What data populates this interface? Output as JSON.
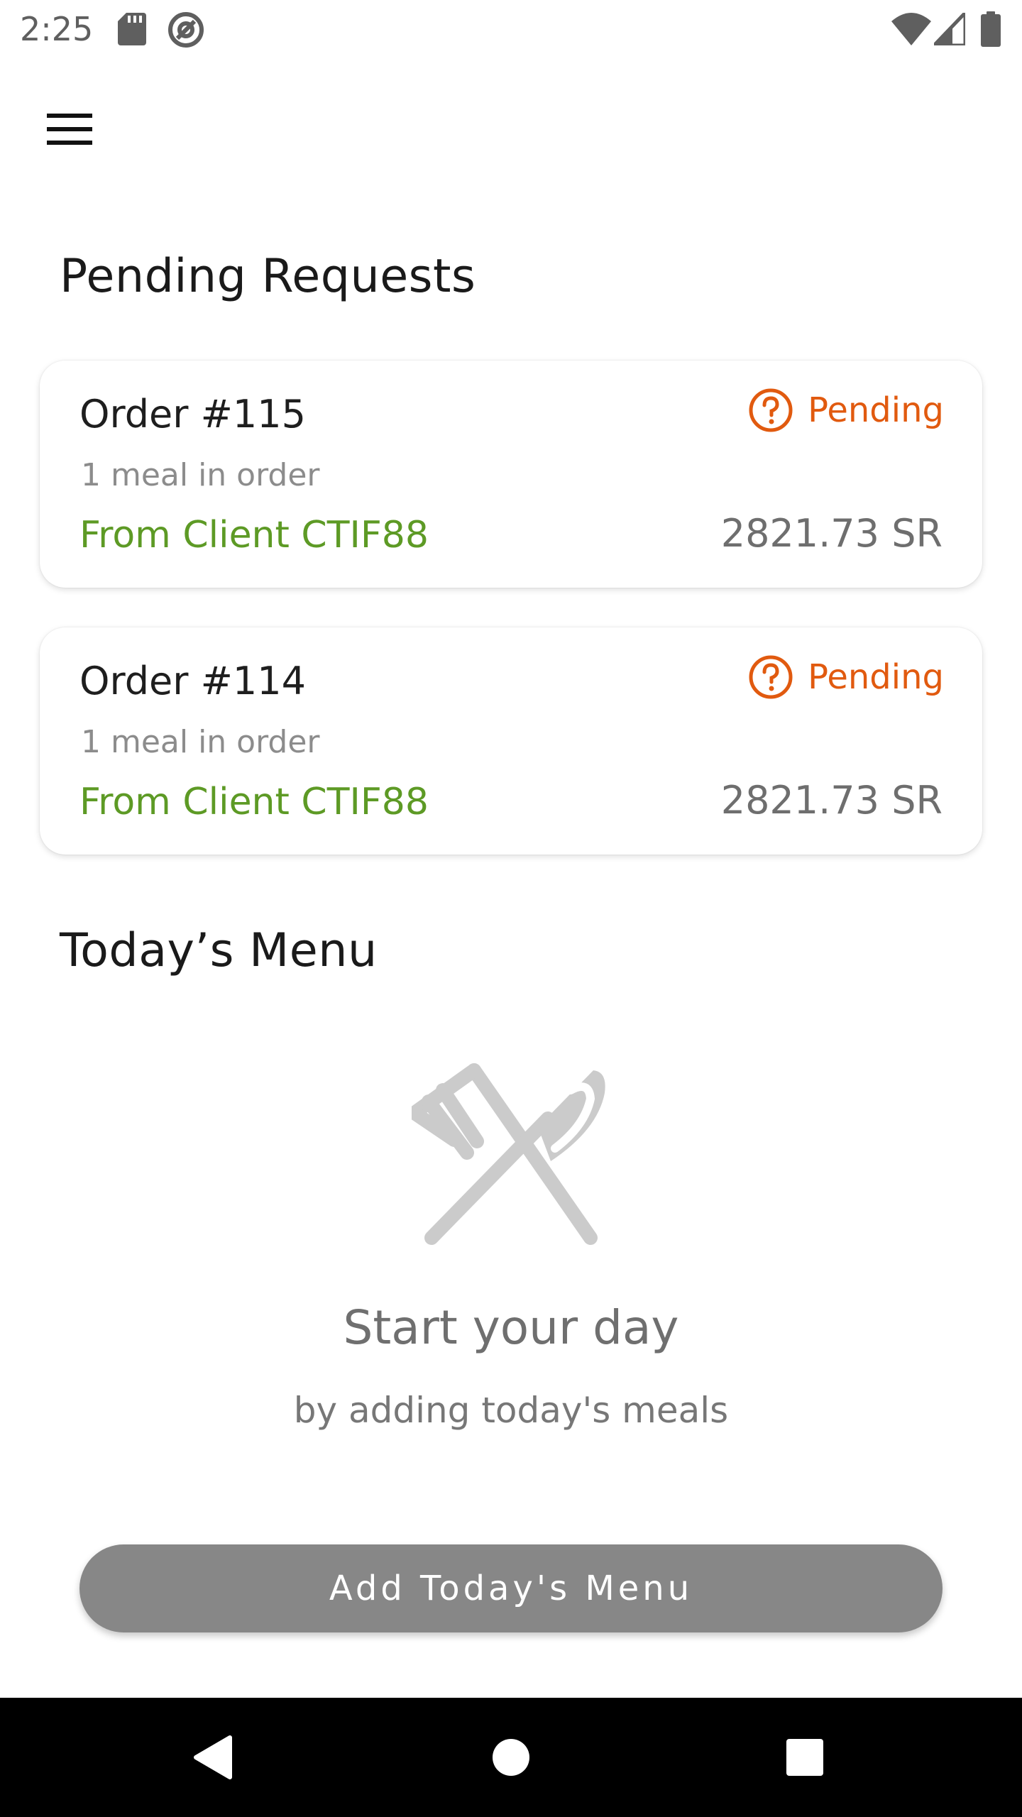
{
  "status_bar": {
    "time": "2:25",
    "left_icons": [
      "sd-card-icon",
      "at-sign-icon"
    ],
    "right_icons": [
      "wifi-icon",
      "cell-signal-icon",
      "battery-icon"
    ]
  },
  "app_bar": {
    "menu_icon": "hamburger-menu-icon"
  },
  "pending_requests": {
    "title": "Pending Requests",
    "orders": [
      {
        "number": "Order #115",
        "meals": "1 meal in order",
        "client": "From Client CTIF88",
        "price": "2821.73 SR",
        "status": "Pending"
      },
      {
        "number": "Order #114",
        "meals": "1 meal in order",
        "client": "From Client CTIF88",
        "price": "2821.73 SR",
        "status": "Pending"
      }
    ]
  },
  "todays_menu": {
    "title": "Today’s Menu",
    "empty_icon": "fork-knife-icon",
    "empty_title": "Start your day",
    "empty_subtitle": "by adding today's meals",
    "button_label": "Add Today's Menu"
  },
  "nav_bar": {
    "items": [
      "back-icon",
      "home-icon",
      "recents-icon"
    ]
  },
  "colors": {
    "pending": "#e15a0f",
    "client": "#5d9a25",
    "button": "#878787",
    "muted_icon": "#cbcbcb"
  }
}
